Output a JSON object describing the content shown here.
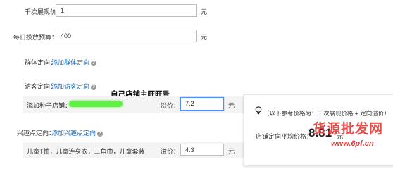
{
  "fields": {
    "cpm_label": "千次展现价格",
    "cpm_value": "1",
    "cpm_unit": "元",
    "budget_label": "每日投放预算：",
    "budget_value": "400",
    "budget_unit": "元"
  },
  "targeting": {
    "group_label": "群体定向：",
    "group_link": "添加群体定向",
    "visitor_label": "访客定向：",
    "visitor_link": "添加访客定向",
    "seed_label": "添加种子店铺：",
    "seed_bid_label": "溢价：",
    "seed_bid_value": "7.2",
    "seed_bid_unit": "元",
    "interest_label": "兴趣点定向：",
    "interest_link": "添加兴趣点定向",
    "interest_item": "儿童T恤，儿童连身衣，三角巾，儿童套装",
    "interest_bid_label": "溢价：",
    "interest_bid_value": "4.3",
    "interest_bid_unit": "元"
  },
  "annotation": "自己店铺主旺旺号",
  "tooltip": {
    "text": "（以下参考价格为：千次展现价格 + 定向溢价）",
    "avg_label": "店铺定向平均价格：",
    "avg_value": "8.81",
    "avg_unit": "元"
  },
  "watermark": {
    "text": "货源批发网",
    "url": "www.6pf.cn"
  },
  "colors": {
    "link": "#1f6ab4",
    "focus_border": "#4d90fe",
    "scribble": "#62f046",
    "watermark": "#e53935"
  }
}
